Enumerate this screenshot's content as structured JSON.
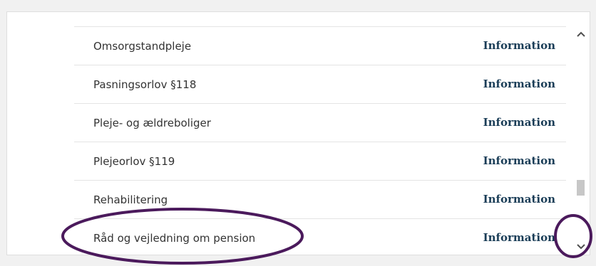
{
  "rows": [
    {
      "label": "Omsorgstandpleje",
      "link": "Information"
    },
    {
      "label": "Pasningsorlov §118",
      "link": "Information"
    },
    {
      "label": "Pleje- og ældreboliger",
      "link": "Information"
    },
    {
      "label": "Plejeorlov §119",
      "link": "Information"
    },
    {
      "label": "Rehabilitering",
      "link": "Information"
    },
    {
      "label": "Råd og vejledning om pension",
      "link": "Information"
    }
  ],
  "scrollbar": {
    "up_icon": "chevron-up-icon",
    "down_icon": "chevron-down-icon"
  },
  "colors": {
    "link": "#1a3d57",
    "annotation": "#4b1a5c"
  }
}
